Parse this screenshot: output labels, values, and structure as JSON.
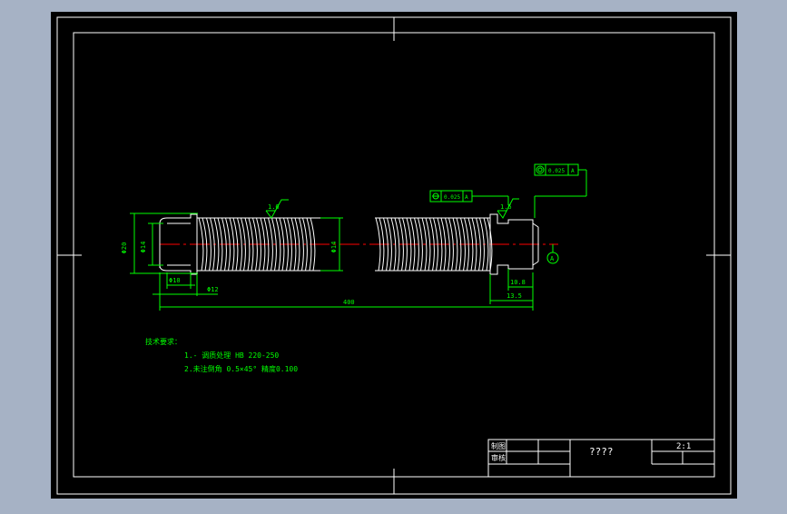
{
  "drawing": {
    "background_color": "#000000",
    "frame_color": "#ffffff",
    "part_color": "#ffffff",
    "dimension_color": "#00ff00",
    "centerline_color": "#ff0000",
    "dimensions": {
      "head_dia": "Φ20",
      "shank_dia": "Φ14",
      "thread_dia": "Φ14",
      "pilot_dia": "Φ10",
      "head_len": "Φ12",
      "overall_len": "400",
      "end_len_1": "10.8",
      "end_len_2": "13.5"
    },
    "roughness": {
      "left": "1.6",
      "right": "1.6"
    },
    "tolerances": {
      "coaxiality": {
        "value": "0.025",
        "datum": "A"
      },
      "runout": {
        "value": "0.025",
        "datum": "A"
      }
    },
    "datum_label": "A",
    "notes": {
      "heading": "技术要求：",
      "items": [
        "1.-  调质处理 HB 220-250",
        "2.未注倒角   0.5×45°   精度0.100"
      ]
    },
    "title_block": {
      "drawn_label": "制图",
      "checked_label": "审核",
      "part_name": "????",
      "scale": "2:1"
    }
  }
}
